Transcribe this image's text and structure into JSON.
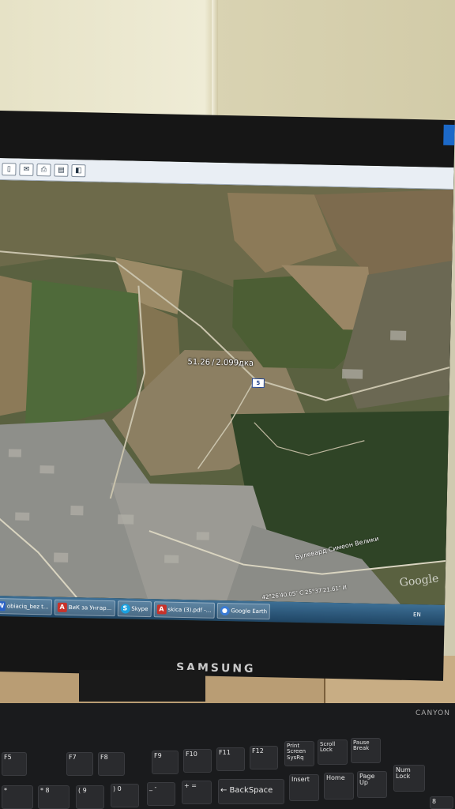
{
  "map": {
    "placemark_label": "51.26 / 2.099дка",
    "road_shield": "5",
    "street_label": "Булевард Симеон Велики",
    "coords_label": "42°26′40.05″ С 25°37′21.61″ И",
    "logo": "Google"
  },
  "toolbar": {
    "icons": [
      "window-icon",
      "mail-icon",
      "print-icon",
      "save-icon",
      "view-icon"
    ]
  },
  "taskbar": {
    "items": [
      {
        "label": "obiaciq_bez t...",
        "icon": "word-icon",
        "color": "#2a62c8",
        "glyph": "W"
      },
      {
        "label": "ВиК за Унгар...",
        "icon": "pdf-icon",
        "color": "#c8322a",
        "glyph": "A"
      },
      {
        "label": "Skype",
        "icon": "skype-icon",
        "color": "#1aa1e0",
        "glyph": "S"
      },
      {
        "label": "skica (3).pdf -...",
        "icon": "pdf-icon",
        "color": "#c8322a",
        "glyph": "A"
      },
      {
        "label": "Google Earth",
        "icon": "earth-icon",
        "color": "#3a7bd5",
        "glyph": "●"
      }
    ],
    "lang": "EN"
  },
  "monitor": {
    "brand": "SAMSUNG"
  },
  "keyboard": {
    "brand": "CANYON",
    "keys": [
      {
        "name": "key-f5",
        "label": "F5"
      },
      {
        "name": "key-f7",
        "label": "F7"
      },
      {
        "name": "key-f8",
        "label": "F8"
      },
      {
        "name": "key-f9",
        "label": "F9"
      },
      {
        "name": "key-f10",
        "label": "F10"
      },
      {
        "name": "key-f11",
        "label": "F11"
      },
      {
        "name": "key-f12",
        "label": "F12"
      },
      {
        "name": "key-print-screen",
        "label": "Print Screen SysRq"
      },
      {
        "name": "key-scroll-lock",
        "label": "Scroll Lock"
      },
      {
        "name": "key-pause-break",
        "label": "Pause Break"
      },
      {
        "name": "key-insert",
        "label": "Insert"
      },
      {
        "name": "key-home",
        "label": "Home"
      },
      {
        "name": "key-page-up",
        "label": "Page Up"
      },
      {
        "name": "key-num-lock",
        "label": "Num Lock"
      },
      {
        "name": "key-backspace",
        "label": "← BackSpace"
      },
      {
        "name": "key-9",
        "label": "( 9"
      },
      {
        "name": "key-0",
        "label": ") 0"
      },
      {
        "name": "key-minus",
        "label": "_ -"
      },
      {
        "name": "key-plus",
        "label": "+ ="
      },
      {
        "name": "key-8",
        "label": "* 8"
      },
      {
        "name": "key-star",
        "label": "*"
      },
      {
        "name": "key-numpad-8",
        "label": "8"
      }
    ]
  }
}
